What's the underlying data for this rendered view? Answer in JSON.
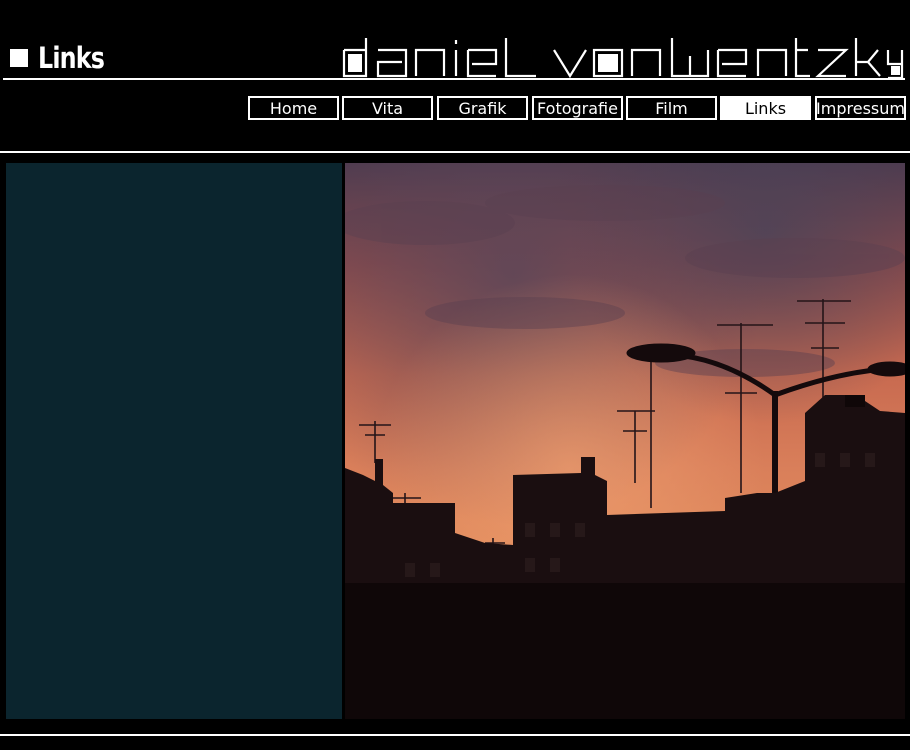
{
  "page": {
    "section_label": "Links",
    "site_title": "daniel von wentzky"
  },
  "nav": {
    "items": [
      {
        "label": "Home",
        "active": false
      },
      {
        "label": "Vita",
        "active": false
      },
      {
        "label": "Grafik",
        "active": false
      },
      {
        "label": "Fotografie",
        "active": false
      },
      {
        "label": "Film",
        "active": false
      },
      {
        "label": "Links",
        "active": true
      },
      {
        "label": "Impressum",
        "active": false
      }
    ]
  },
  "colors": {
    "background": "#000000",
    "panel": "#0b252e",
    "foreground": "#ffffff"
  },
  "photo": {
    "subject": "sunset-rooftops-photo"
  }
}
